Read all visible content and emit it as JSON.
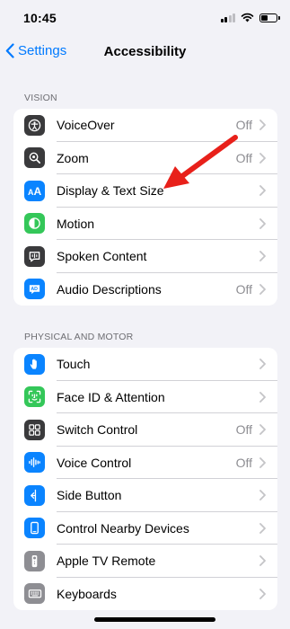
{
  "status_bar": {
    "time": "10:45",
    "battery_level": 0.45
  },
  "nav": {
    "back_label": "Settings",
    "title": "Accessibility"
  },
  "sections": [
    {
      "header": "VISION",
      "rows": [
        {
          "name": "voiceover",
          "label": "VoiceOver",
          "value": "Off",
          "icon": "voiceover-icon",
          "icon_color": "#3a3a3c"
        },
        {
          "name": "zoom",
          "label": "Zoom",
          "value": "Off",
          "icon": "zoom-icon",
          "icon_color": "#3a3a3c"
        },
        {
          "name": "display-text-size",
          "label": "Display & Text Size",
          "value": "",
          "icon": "text-size-icon",
          "icon_color": "#0a84ff"
        },
        {
          "name": "motion",
          "label": "Motion",
          "value": "",
          "icon": "motion-icon",
          "icon_color": "#34c759"
        },
        {
          "name": "spoken-content",
          "label": "Spoken Content",
          "value": "",
          "icon": "speech-bubble-icon",
          "icon_color": "#3a3a3c"
        },
        {
          "name": "audio-descriptions",
          "label": "Audio Descriptions",
          "value": "Off",
          "icon": "audio-description-icon",
          "icon_color": "#0a84ff"
        }
      ]
    },
    {
      "header": "PHYSICAL AND MOTOR",
      "rows": [
        {
          "name": "touch",
          "label": "Touch",
          "value": "",
          "icon": "hand-touch-icon",
          "icon_color": "#0a84ff"
        },
        {
          "name": "face-id-attention",
          "label": "Face ID & Attention",
          "value": "",
          "icon": "face-id-icon",
          "icon_color": "#34c759"
        },
        {
          "name": "switch-control",
          "label": "Switch Control",
          "value": "Off",
          "icon": "switch-grid-icon",
          "icon_color": "#3a3a3c"
        },
        {
          "name": "voice-control",
          "label": "Voice Control",
          "value": "Off",
          "icon": "voice-waveform-icon",
          "icon_color": "#0a84ff"
        },
        {
          "name": "side-button",
          "label": "Side Button",
          "value": "",
          "icon": "side-button-icon",
          "icon_color": "#0a84ff"
        },
        {
          "name": "control-nearby-devices",
          "label": "Control Nearby Devices",
          "value": "",
          "icon": "device-icon",
          "icon_color": "#0a84ff"
        },
        {
          "name": "apple-tv-remote",
          "label": "Apple TV Remote",
          "value": "",
          "icon": "tv-remote-icon",
          "icon_color": "#8e8e93"
        },
        {
          "name": "keyboards",
          "label": "Keyboards",
          "value": "",
          "icon": "keyboard-icon",
          "icon_color": "#8e8e93"
        }
      ]
    }
  ],
  "annotation": {
    "type": "red-arrow",
    "target": "display-text-size",
    "color": "#e8201a"
  }
}
